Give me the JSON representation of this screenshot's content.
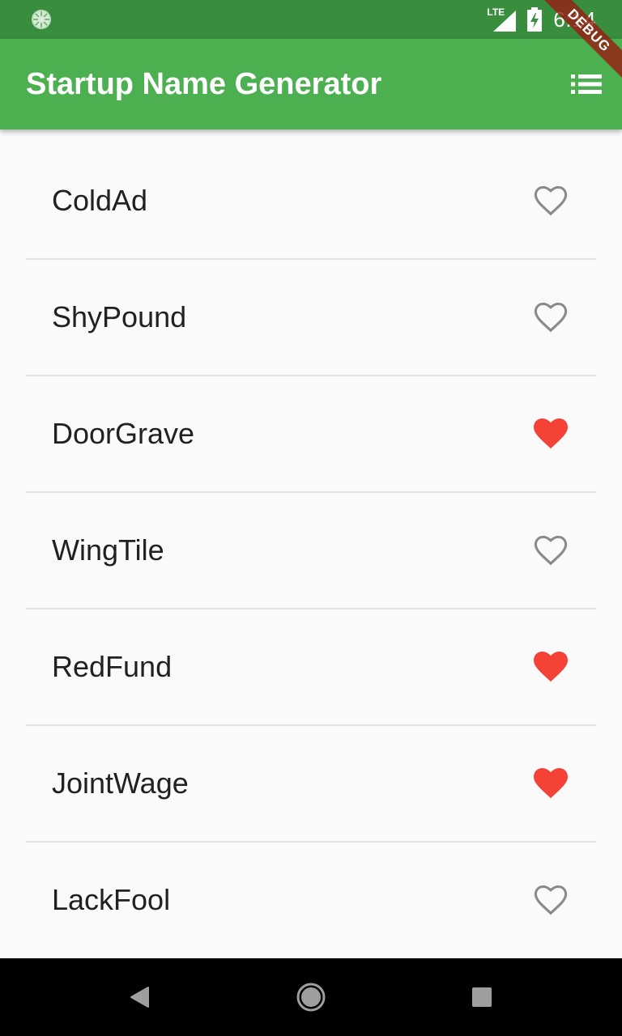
{
  "status_bar": {
    "time": "6:14",
    "network": "LTE",
    "background": "#388e3c"
  },
  "debug_banner": {
    "label": "DEBUG"
  },
  "app_bar": {
    "title": "Startup Name Generator",
    "background": "#4caf50",
    "action_icon": "list-icon"
  },
  "list": {
    "items": [
      {
        "name": "ColdAd",
        "saved": false
      },
      {
        "name": "ShyPound",
        "saved": false
      },
      {
        "name": "DoorGrave",
        "saved": true
      },
      {
        "name": "WingTile",
        "saved": false
      },
      {
        "name": "RedFund",
        "saved": true
      },
      {
        "name": "JointWage",
        "saved": true
      },
      {
        "name": "LackFool",
        "saved": false
      }
    ],
    "saved_color": "#f44336",
    "unsaved_color": "#8a8a8a"
  },
  "nav_bar": {
    "buttons": [
      "back-icon",
      "home-icon",
      "recents-icon"
    ]
  }
}
